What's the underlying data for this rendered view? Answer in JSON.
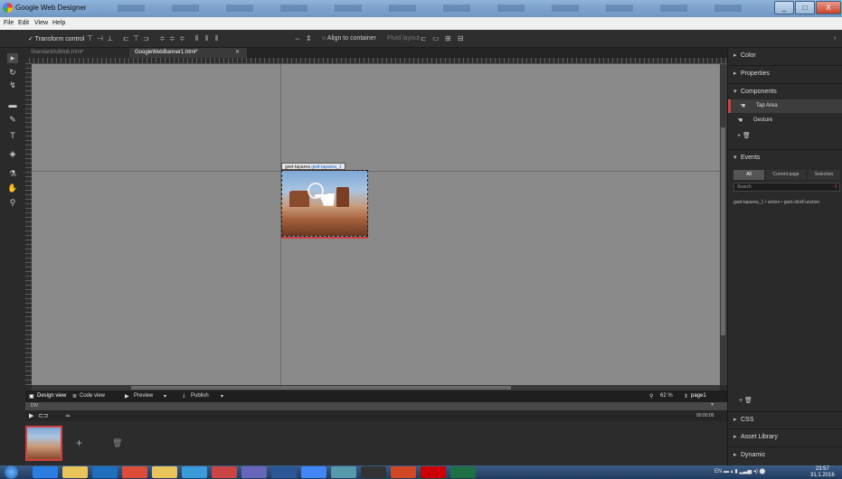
{
  "window": {
    "title": "Google Web Designer",
    "minimize": "_",
    "maximize": "□",
    "close": "X"
  },
  "menu": [
    "File",
    "Edit",
    "View",
    "Help"
  ],
  "toolstrip": {
    "transform_control": "✓ Transform control",
    "align_to_container": "○ Align to container",
    "fluid_layout": "Fluid layout",
    "more": "›"
  },
  "doc_tabs": [
    {
      "label": "StandardAdMob.html*",
      "close": "✕"
    },
    {
      "label": "GoogleWebBanner1.html*",
      "close": "✕"
    }
  ],
  "stage": {
    "banner_label": "gwd-taparea",
    "banner_label_selected": "gwd-taparea_1"
  },
  "bottom_bar": {
    "design_view": "Design view",
    "code_view": "Code view",
    "preview": "Preview",
    "publish": "Publish",
    "zoom": "62 %",
    "page": "page1"
  },
  "timeline": {
    "div_label": "DIV",
    "time": "00:00:00",
    "add": "+",
    "delete": "🗑"
  },
  "right_panel": {
    "color": "Color",
    "properties": "Properties",
    "components": "Components",
    "component_items": [
      "Tap Area",
      "Gesture"
    ],
    "add_row": "+ 🗑",
    "events": "Events",
    "event_tabs": [
      "All",
      "Current page",
      "Selection"
    ],
    "search_label": "Search",
    "event_row": "gwd-taparea_1 • action • gwd.clickFunction",
    "add_row_2": "+ 🗑",
    "css": "CSS",
    "asset_library": "Asset Library",
    "dynamic": "Dynamic"
  },
  "taskbar": {
    "apps": [
      {
        "icon": "ie-icon",
        "color": "#2a7de1"
      },
      {
        "icon": "folder-icon",
        "color": "#e8c45a"
      },
      {
        "icon": "outlook-icon",
        "color": "#1f6fc0"
      },
      {
        "icon": "chrome-icon",
        "color": "#dd4b39"
      },
      {
        "icon": "explorer-icon",
        "color": "#e8c45a"
      },
      {
        "icon": "gwd-icon",
        "color": "#3a9bd8"
      },
      {
        "icon": "paint-icon",
        "color": "#c44"
      },
      {
        "icon": "media-icon",
        "color": "#66b"
      },
      {
        "icon": "word-icon",
        "color": "#2b5797"
      },
      {
        "icon": "gwd2-icon",
        "color": "#4285f4"
      },
      {
        "icon": "photo-icon",
        "color": "#59a"
      },
      {
        "icon": "cmd-icon",
        "color": "#333"
      },
      {
        "icon": "powerpoint-icon",
        "color": "#d24726"
      },
      {
        "icon": "acrobat-icon",
        "color": "#c00"
      },
      {
        "icon": "excel-icon",
        "color": "#1e7145"
      }
    ],
    "clock_time": "23:57",
    "clock_date": "31.1.2016"
  }
}
